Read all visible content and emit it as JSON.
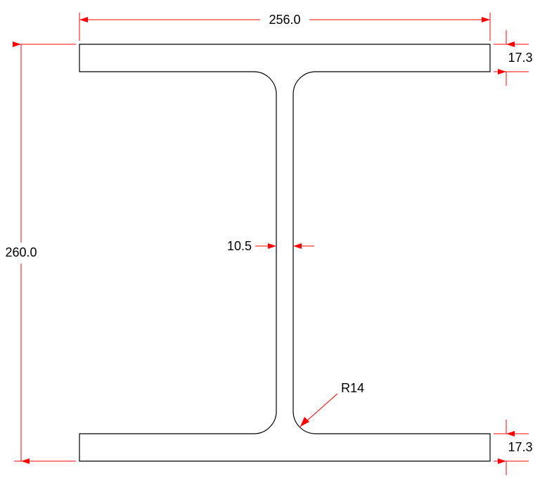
{
  "diagram": {
    "type": "engineering-drawing",
    "shape": "I-beam-cross-section"
  },
  "dimensions": {
    "width": "256.0",
    "height": "260.0",
    "flange_thickness_top": "17.3",
    "flange_thickness_bottom": "17.3",
    "web_thickness": "10.5",
    "fillet_radius": "R14"
  },
  "colors": {
    "dimension": "#ff0000",
    "outline": "#000000",
    "text": "#000000"
  }
}
